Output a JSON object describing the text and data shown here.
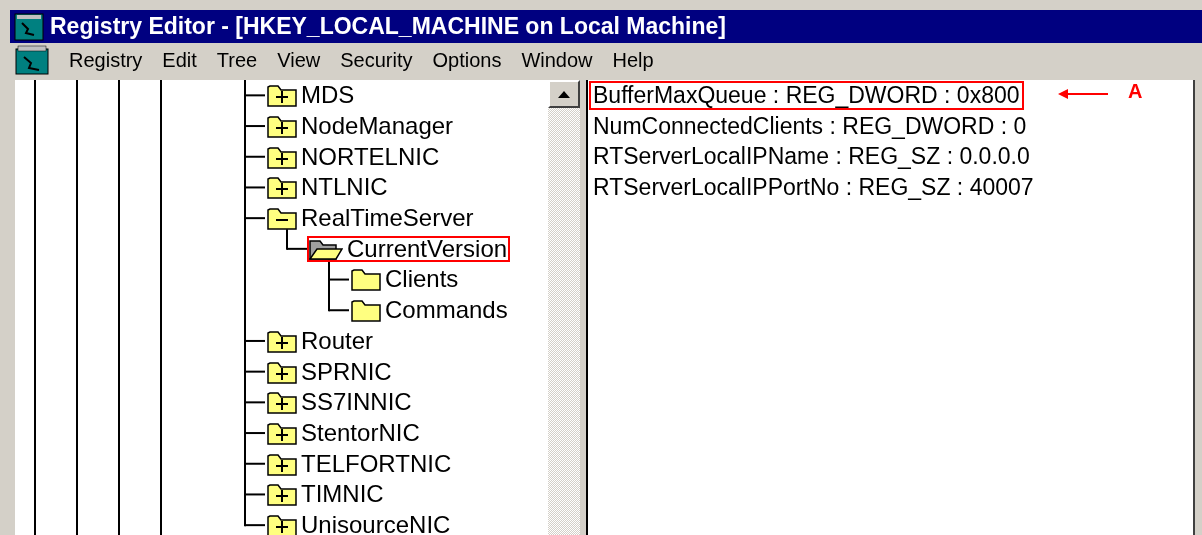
{
  "window": {
    "title": "Registry Editor - [HKEY_LOCAL_MACHINE on Local Machine]"
  },
  "menu": [
    "Registry",
    "Edit",
    "Tree",
    "View",
    "Security",
    "Options",
    "Window",
    "Help"
  ],
  "tree": [
    {
      "label": "MDS",
      "expanded": false
    },
    {
      "label": "NodeManager",
      "expanded": false
    },
    {
      "label": "NORTELNIC",
      "expanded": false
    },
    {
      "label": "NTLNIC",
      "expanded": false
    },
    {
      "label": "RealTimeServer",
      "expanded": true,
      "children": [
        {
          "label": "CurrentVersion",
          "selected": true,
          "callout": true,
          "children": [
            {
              "label": "Clients",
              "selected": false
            },
            {
              "label": "Commands",
              "selected": false
            }
          ]
        }
      ]
    },
    {
      "label": "Router",
      "expanded": false
    },
    {
      "label": "SPRNIC",
      "expanded": false
    },
    {
      "label": "SS7INNIC",
      "expanded": false
    },
    {
      "label": "StentorNIC",
      "expanded": false
    },
    {
      "label": "TELFORTNIC",
      "expanded": false
    },
    {
      "label": "TIMNIC",
      "expanded": false
    },
    {
      "label": "UnisourceNIC",
      "expanded": false
    }
  ],
  "values": [
    {
      "text": "BufferMaxQueue : REG_DWORD : 0x800",
      "callout": true
    },
    {
      "text": "NumConnectedClients : REG_DWORD : 0",
      "callout": false
    },
    {
      "text": "RTServerLocalIPName : REG_SZ : 0.0.0.0",
      "callout": false
    },
    {
      "text": "RTServerLocalIPPortNo : REG_SZ : 40007",
      "callout": false
    }
  ],
  "annotation": {
    "label": "A"
  }
}
